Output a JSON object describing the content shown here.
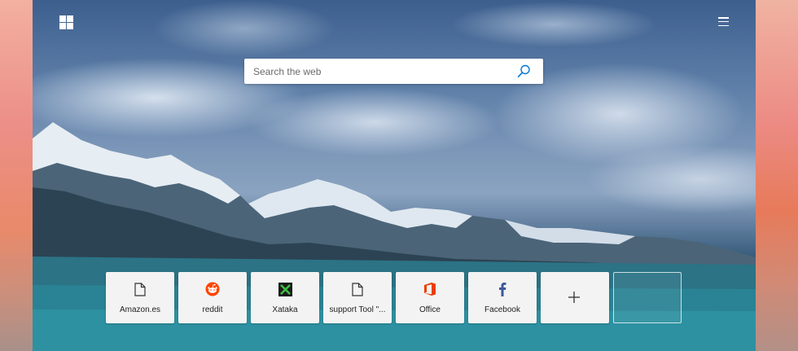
{
  "search": {
    "placeholder": "Search the web"
  },
  "icons": {
    "logo": "windows-logo",
    "menu": "hamburger-menu-icon",
    "search": "search-icon"
  },
  "tiles": [
    {
      "label": "Amazon.es",
      "icon": "page-icon"
    },
    {
      "label": "reddit",
      "icon": "reddit-icon",
      "color": "#ff4500"
    },
    {
      "label": "Xataka",
      "icon": "xataka-icon",
      "color": "#2a8c2a"
    },
    {
      "label": "support Tool \"...",
      "icon": "page-icon"
    },
    {
      "label": "Office",
      "icon": "office-icon",
      "color": "#eb3c00"
    },
    {
      "label": "Facebook",
      "icon": "facebook-icon",
      "color": "#3b5998"
    }
  ],
  "add_tile": {
    "icon": "plus-icon"
  },
  "colors": {
    "accent": "#0078d7",
    "tile_background": "#f3f3f3"
  }
}
